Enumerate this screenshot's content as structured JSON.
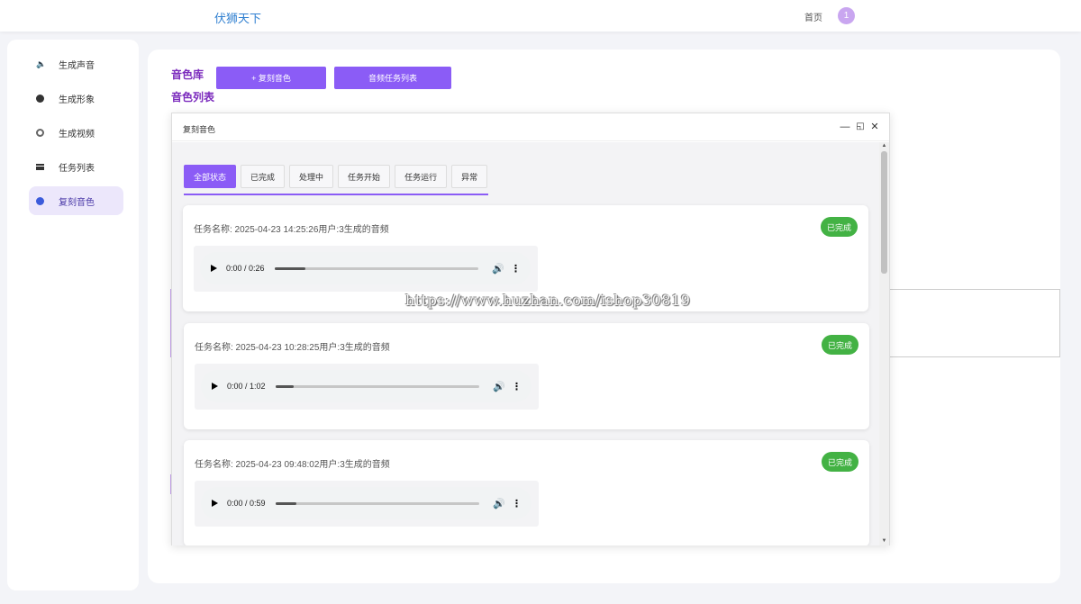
{
  "header": {
    "brand": "伏狮天下",
    "nav_home": "首页",
    "avatar_text": "1"
  },
  "sidebar": {
    "items": [
      {
        "label": "生成声音",
        "icon": "speaker-icon",
        "active": false
      },
      {
        "label": "生成形象",
        "icon": "person-icon",
        "active": false
      },
      {
        "label": "生成视频",
        "icon": "video-dot-icon",
        "active": false
      },
      {
        "label": "任务列表",
        "icon": "list-icon",
        "active": false
      },
      {
        "label": "复刻音色",
        "icon": "voice-clone-icon",
        "active": true
      }
    ]
  },
  "main": {
    "label_library": "音色库",
    "label_list": "音色列表",
    "clone_button": "+ 复刻音色",
    "task_list_button": "音频任务列表"
  },
  "dialog": {
    "title": "复刻音色",
    "tabs": [
      {
        "label": "全部状态",
        "active": true
      },
      {
        "label": "已完成",
        "active": false
      },
      {
        "label": "处理中",
        "active": false
      },
      {
        "label": "任务开始",
        "active": false
      },
      {
        "label": "任务运行",
        "active": false
      },
      {
        "label": "异常",
        "active": false
      }
    ],
    "tasks": [
      {
        "title": "任务名称:  2025-04-23 14:25:26用户:3生成的音频",
        "status": "已完成",
        "time": "0:00 / 0:26",
        "progress": 0.15
      },
      {
        "title": "任务名称:  2025-04-23 10:28:25用户:3生成的音频",
        "status": "已完成",
        "time": "0:00 / 1:02",
        "progress": 0.09
      },
      {
        "title": "任务名称:  2025-04-23 09:48:02用户:3生成的音频",
        "status": "已完成",
        "time": "0:00 / 0:59",
        "progress": 0.1
      }
    ]
  },
  "watermark": "https://www.huzhan.com/ishop30819",
  "colors": {
    "accent": "#8b5cf6",
    "status_done": "#43b244",
    "brand": "#2f7fd0"
  }
}
